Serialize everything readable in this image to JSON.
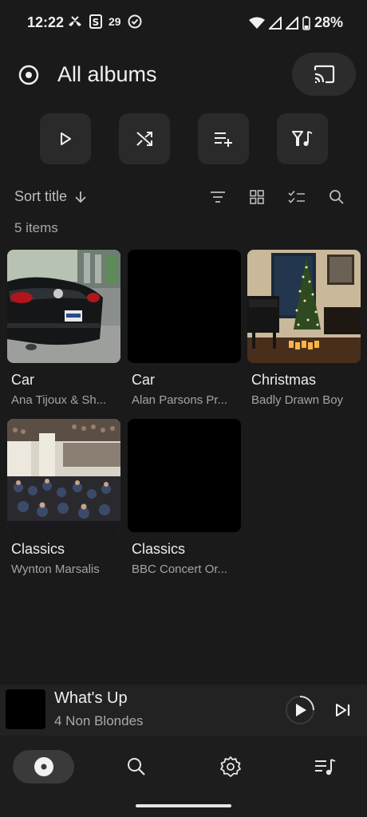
{
  "status_bar": {
    "time": "12:22",
    "notif_badge": "29",
    "battery": "28%"
  },
  "header": {
    "title": "All albums"
  },
  "actions": [
    {
      "icon": "play-icon"
    },
    {
      "icon": "shuffle-icon"
    },
    {
      "icon": "add-to-queue-icon"
    },
    {
      "icon": "filter-music-icon"
    }
  ],
  "sort": {
    "label": "Sort title"
  },
  "item_count": "5 items",
  "albums": [
    {
      "title": "Car",
      "artist": "Ana Tijoux & Sh..."
    },
    {
      "title": "Car",
      "artist": "Alan Parsons Pr..."
    },
    {
      "title": "Christmas",
      "artist": "Badly Drawn Boy"
    },
    {
      "title": "Classics",
      "artist": "Wynton Marsalis"
    },
    {
      "title": "Classics",
      "artist": "BBC Concert Or..."
    }
  ],
  "now_playing": {
    "title": "What's Up",
    "artist": "4 Non Blondes"
  },
  "nav": [
    {
      "icon": "album-icon",
      "active": true
    },
    {
      "icon": "search-icon"
    },
    {
      "icon": "settings-icon"
    },
    {
      "icon": "queue-icon"
    }
  ]
}
